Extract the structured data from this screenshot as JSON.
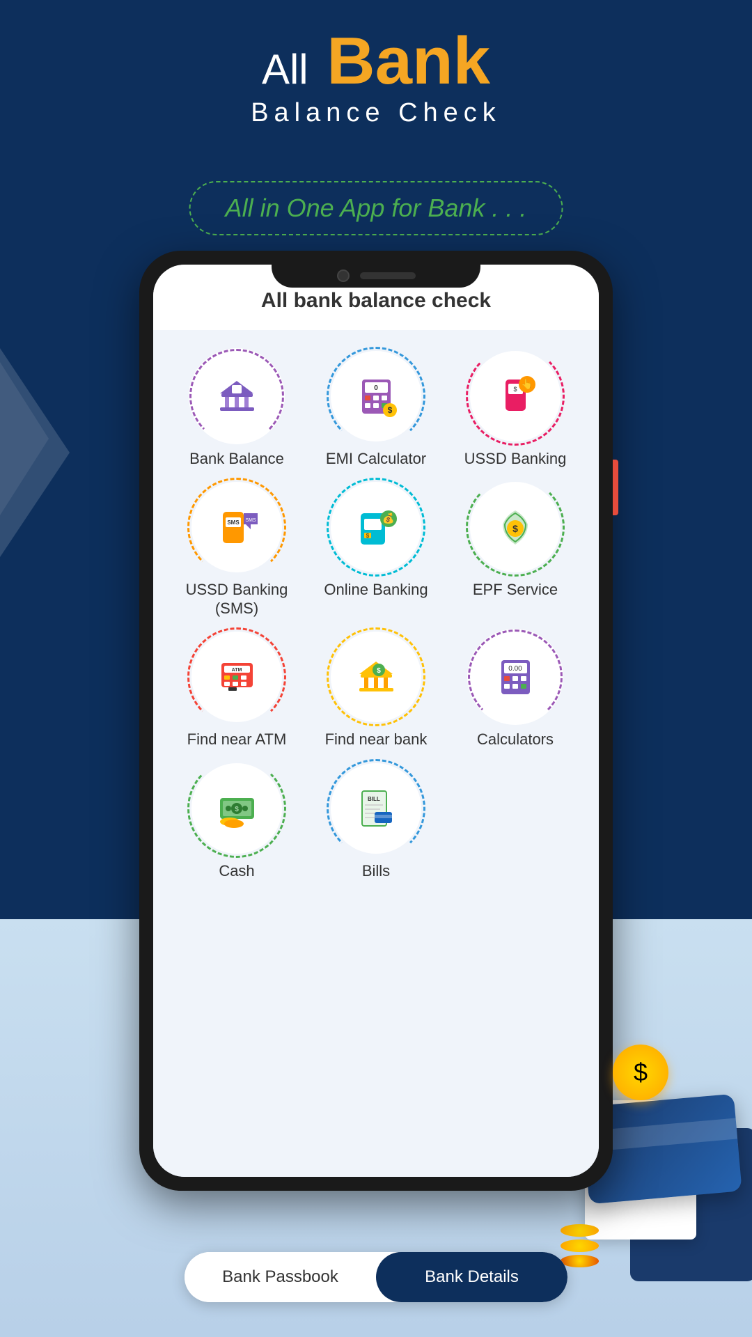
{
  "app": {
    "title_all": "All",
    "title_bank": "Bank",
    "subtitle": "Balance Check",
    "tagline": "All in One App for Bank . . ."
  },
  "screen": {
    "header": "All bank balance check"
  },
  "features": [
    {
      "id": "bank-balance",
      "label": "Bank Balance",
      "icon": "🏛️",
      "circle": "circle-purple"
    },
    {
      "id": "emi-calculator",
      "label": "EMI Calculator",
      "icon": "🧮",
      "circle": "circle-blue"
    },
    {
      "id": "ussd-banking",
      "label": "USSD Banking",
      "icon": "📱",
      "circle": "circle-pink"
    },
    {
      "id": "ussd-sms",
      "label": "USSD Banking\n(SMS)",
      "icon": "💬",
      "circle": "circle-orange"
    },
    {
      "id": "online-banking",
      "label": "Online Banking",
      "icon": "💻",
      "circle": "circle-teal"
    },
    {
      "id": "epf-service",
      "label": "EPF Service",
      "icon": "💰",
      "circle": "circle-green"
    },
    {
      "id": "find-atm",
      "label": "Find near ATM",
      "icon": "🏧",
      "circle": "circle-red"
    },
    {
      "id": "find-bank",
      "label": "Find near bank",
      "icon": "🏦",
      "circle": "circle-gold"
    },
    {
      "id": "calculators",
      "label": "Calculators",
      "icon": "🔢",
      "circle": "circle-purple"
    },
    {
      "id": "cash",
      "label": "Cash",
      "icon": "💵",
      "circle": "circle-green"
    },
    {
      "id": "bills",
      "label": "Bills",
      "icon": "🧾",
      "circle": "circle-blue"
    }
  ],
  "tabs": [
    {
      "id": "passbook",
      "label": "Bank Passbook",
      "active": false
    },
    {
      "id": "details",
      "label": "Bank Details",
      "active": true
    }
  ],
  "colors": {
    "bg_dark": "#0d2f5c",
    "accent_orange": "#f5a623",
    "accent_green": "#4caf50",
    "phone_bg": "#e8f0f8"
  }
}
